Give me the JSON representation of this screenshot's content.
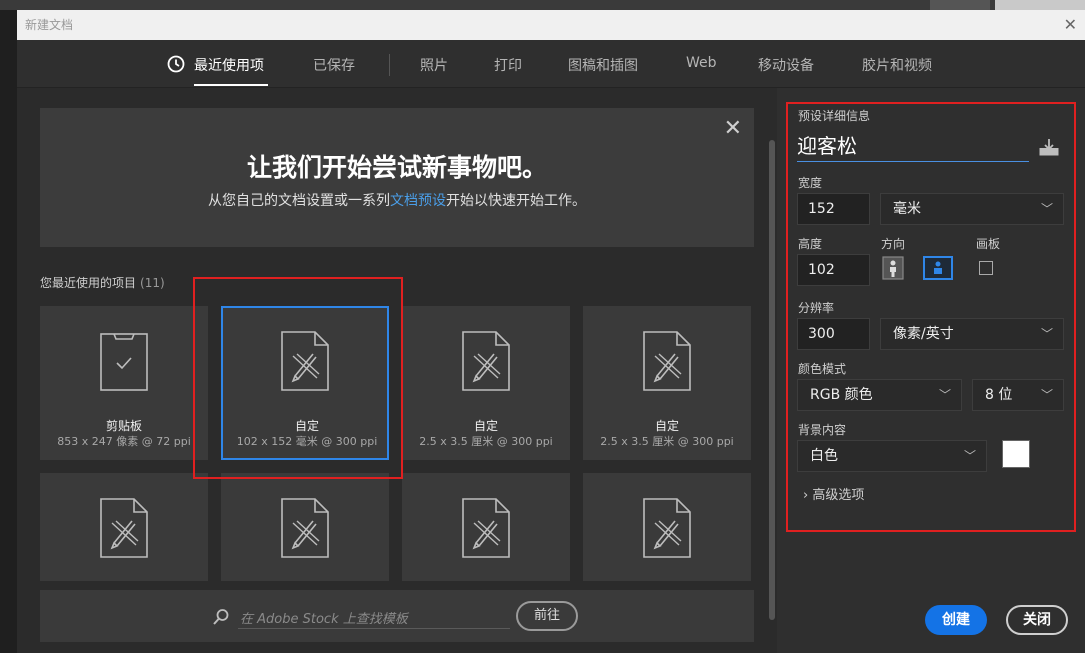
{
  "window": {
    "title": "新建文档",
    "close_glyph": "✕"
  },
  "tabs": [
    {
      "label": "最近使用项",
      "icon": "clock-icon"
    },
    {
      "label": "已保存"
    },
    {
      "label": "照片"
    },
    {
      "label": "打印"
    },
    {
      "label": "图稿和插图"
    },
    {
      "label": "Web"
    },
    {
      "label": "移动设备"
    },
    {
      "label": "胶片和视频"
    }
  ],
  "banner": {
    "heading": "让我们开始尝试新事物吧。",
    "text_before": "从您自己的文档设置或一系列",
    "link": "文档预设",
    "text_after": "开始以快速开始工作。",
    "close_glyph": "✕"
  },
  "recent": {
    "label": "您最近使用的项目",
    "count": "(11)",
    "items": [
      {
        "name": "剪贴板",
        "meta": "853 x 247 像素 @ 72 ppi",
        "icon": "clipboard-icon"
      },
      {
        "name": "自定",
        "meta": "102 x 152 毫米 @ 300 ppi",
        "icon": "document-pencil-icon"
      },
      {
        "name": "自定",
        "meta": "2.5 x 3.5 厘米 @ 300 ppi",
        "icon": "document-pencil-icon"
      },
      {
        "name": "自定",
        "meta": "2.5 x 3.5 厘米 @ 300 ppi",
        "icon": "document-pencil-icon"
      },
      {
        "name": "",
        "meta": "",
        "icon": "document-pencil-icon"
      },
      {
        "name": "",
        "meta": "",
        "icon": "document-pencil-icon"
      },
      {
        "name": "",
        "meta": "",
        "icon": "document-pencil-icon"
      },
      {
        "name": "",
        "meta": "",
        "icon": "document-pencil-icon"
      }
    ]
  },
  "search": {
    "placeholder": "在 Adobe Stock 上查找模板",
    "go_label": "前往"
  },
  "preset": {
    "section_label": "预设详细信息",
    "name": "迎客松",
    "width_label": "宽度",
    "width_value": "152",
    "width_unit": "毫米",
    "height_label": "高度",
    "height_value": "102",
    "orientation_label": "方向",
    "artboard_label": "画板",
    "resolution_label": "分辨率",
    "resolution_value": "300",
    "resolution_unit": "像素/英寸",
    "color_mode_label": "颜色模式",
    "color_mode": "RGB 颜色",
    "bit_depth": "8 位",
    "background_label": "背景内容",
    "background": "白色",
    "background_color": "#ffffff",
    "advanced_label": "高级选项",
    "chevron_glyph": "﹀",
    "advanced_glyph": "›"
  },
  "buttons": {
    "create": "创建",
    "close": "关闭"
  },
  "colors": {
    "accent": "#1473e6",
    "selection": "#2f86e8",
    "annotation_red": "#e02020"
  }
}
